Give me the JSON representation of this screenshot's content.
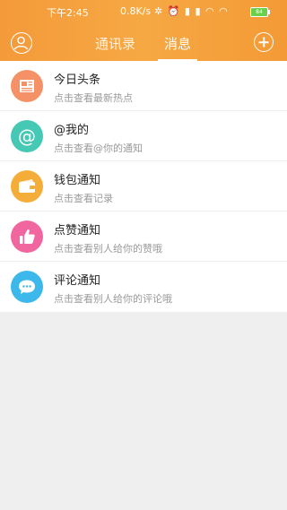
{
  "status_bar": {
    "time": "下午2:45",
    "net_speed": "0.8K/s",
    "battery": "84"
  },
  "header": {
    "tabs": [
      {
        "label": "通讯录",
        "active": false
      },
      {
        "label": "消息",
        "active": true
      }
    ],
    "accent_color": "#f6a843"
  },
  "messages": [
    {
      "title": "今日头条",
      "subtitle": "点击查看最新热点",
      "icon": "newspaper-icon",
      "color": "#f59166"
    },
    {
      "title": "@我的",
      "subtitle": "点击查看@你的通知",
      "icon": "at-sign-icon",
      "color": "#45c8b4"
    },
    {
      "title": "钱包通知",
      "subtitle": "点击查看记录",
      "icon": "wallet-icon",
      "color": "#f5ad3a"
    },
    {
      "title": "点赞通知",
      "subtitle": "点击查看别人给你的赞哦",
      "icon": "thumbs-up-icon",
      "color": "#f2669f"
    },
    {
      "title": "评论通知",
      "subtitle": "点击查看别人给你的评论哦",
      "icon": "comment-icon",
      "color": "#3cb8ea"
    }
  ]
}
